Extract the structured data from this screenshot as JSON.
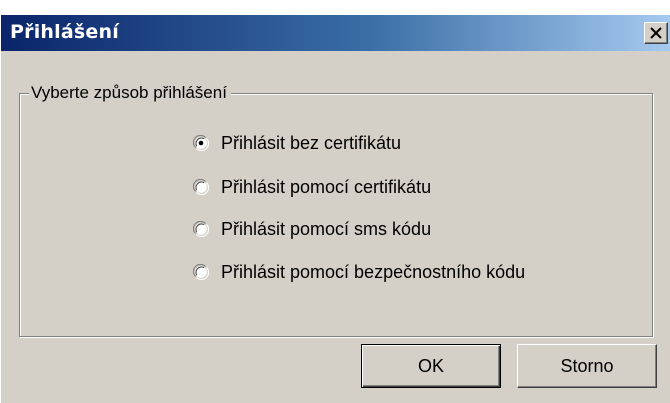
{
  "window": {
    "title": "Přihlášení"
  },
  "group": {
    "legend": "Vyberte způsob přihlášení"
  },
  "options": [
    {
      "label": "Přihlásit bez certifikátu",
      "selected": true
    },
    {
      "label": "Přihlásit pomocí certifikátu",
      "selected": false
    },
    {
      "label": "Přihlásit pomocí sms kódu",
      "selected": false
    },
    {
      "label": "Přihlásit pomocí bezpečnostního kódu",
      "selected": false
    }
  ],
  "buttons": {
    "ok_label": "OK",
    "cancel_label": "Storno"
  },
  "icons": {
    "close": "close-icon",
    "radio": "radio-button-icon"
  },
  "colors": {
    "titlebar_start": "#0a246a",
    "titlebar_end": "#a6caf0",
    "dialog_face": "#d4d0c8"
  }
}
